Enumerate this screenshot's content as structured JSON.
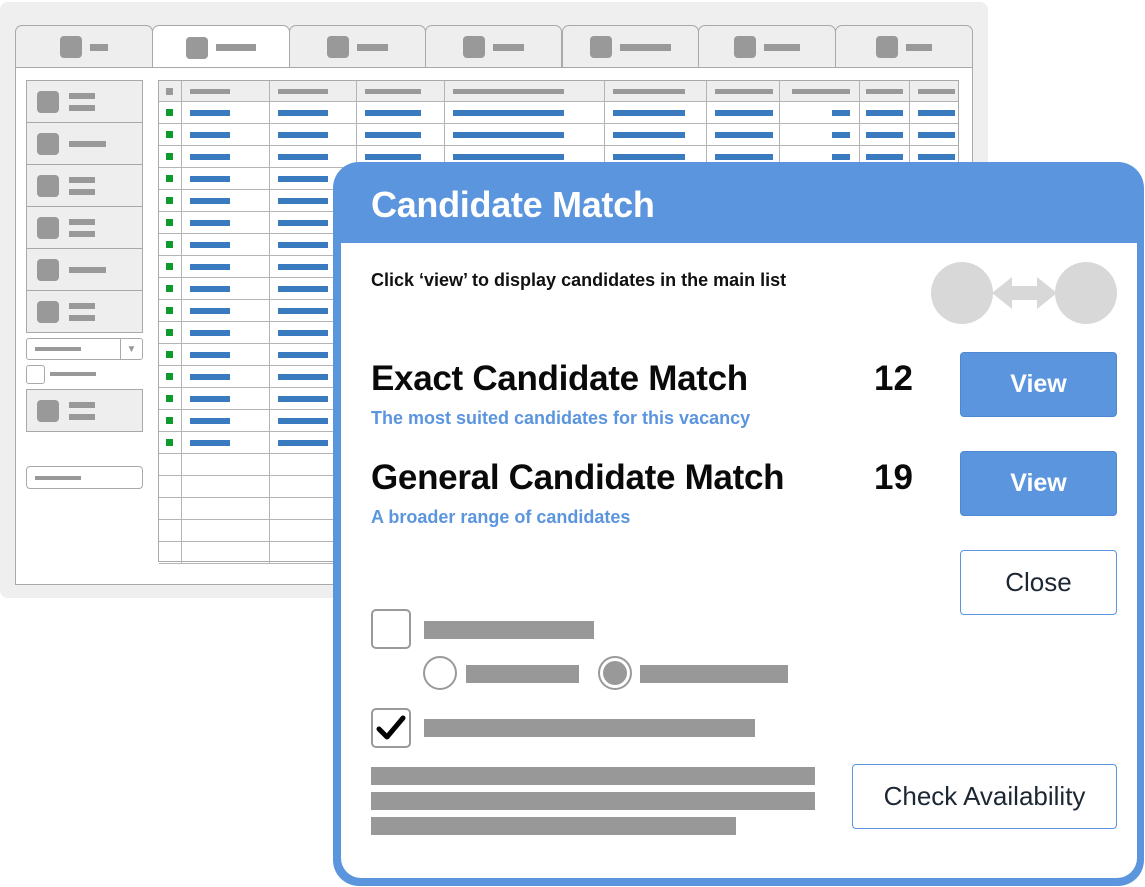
{
  "background_app": {
    "tabs": [
      {
        "name": "tab-1",
        "active": false,
        "label_bar": "short"
      },
      {
        "name": "tab-2",
        "active": true,
        "label_bar": "long"
      },
      {
        "name": "tab-3",
        "active": false,
        "label_bar": "medium"
      },
      {
        "name": "tab-4",
        "active": false,
        "label_bar": "medium"
      },
      {
        "name": "tab-5",
        "active": false,
        "label_bar": "long"
      },
      {
        "name": "tab-6",
        "active": false,
        "label_bar": "medium"
      },
      {
        "name": "tab-7",
        "active": false,
        "label_bar": "medium"
      }
    ],
    "sidebar_buttons": 7,
    "grid": {
      "data_rows": 16,
      "empty_rows": 5,
      "status_color": "#0f9a2e",
      "value_color": "#3a7bbf"
    }
  },
  "dialog": {
    "title": "Candidate Match",
    "instruction": "Click ‘view’ to display candidates in the main list",
    "illustration_icon": "match-arrows-icon",
    "matches": [
      {
        "title": "Exact Candidate Match",
        "subtitle": "The most suited candidates for this vacancy",
        "count": "12",
        "button_label": "View"
      },
      {
        "title": "General Candidate Match",
        "subtitle": "A broader range of candidates",
        "count": "19",
        "button_label": "View"
      }
    ],
    "close_label": "Close",
    "check_availability_label": "Check Availability",
    "options": {
      "checkbox_1_checked": false,
      "radio_selected": 2,
      "checkbox_2_checked": true
    },
    "accent_color": "#5b95de"
  }
}
